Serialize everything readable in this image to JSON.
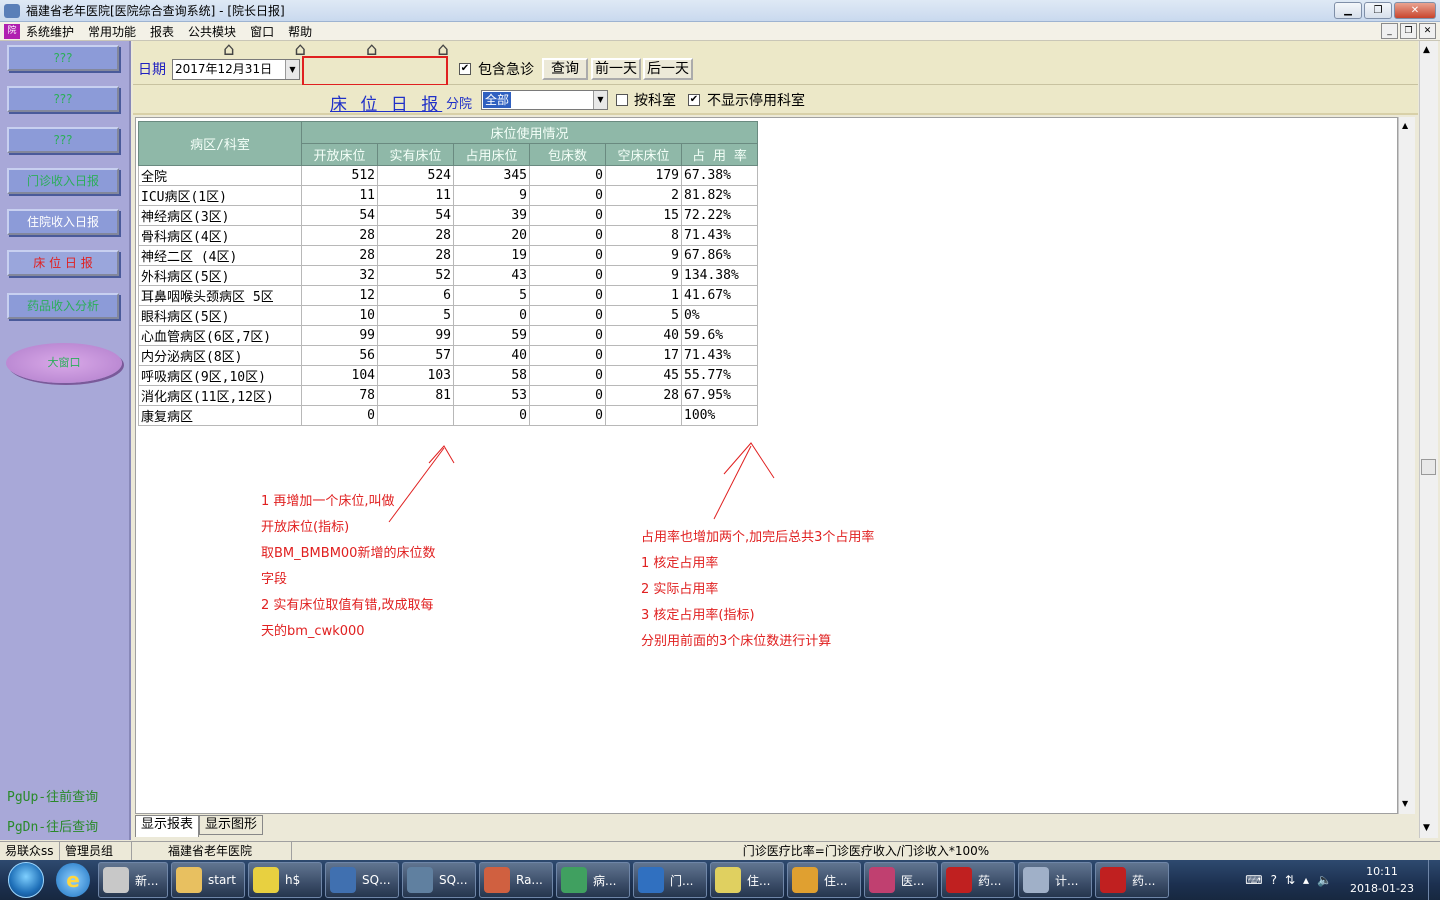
{
  "window": {
    "title": "福建省老年医院[医院综合查询系统] - [院长日报]"
  },
  "menu": {
    "items": [
      "系统维护",
      "常用功能",
      "报表",
      "公共模块",
      "窗口",
      "帮助"
    ]
  },
  "sidebar": {
    "buttons": [
      "???",
      "???",
      "???",
      "门诊收入日报",
      "住院收入日报",
      "床 位 日 报",
      "药品收入分析"
    ],
    "oval_label": "大窗口",
    "hint_up": "PgUp-往前查询",
    "hint_down": "PgDn-往后查询"
  },
  "toolbar": {
    "date_label": "日期",
    "date_value": "2017年12月31日",
    "include_emergency_label": "包含急诊",
    "include_emergency_checked": true,
    "query_button": "查询",
    "prev_day_button": "前一天",
    "next_day_button": "后一天",
    "report_title": "床 位 日 报",
    "branch_label": "分院",
    "branch_value": "全部",
    "by_dept_label": "按科室",
    "by_dept_checked": false,
    "hide_disabled_label": "不显示停用科室",
    "hide_disabled_checked": true
  },
  "table": {
    "corner_header": "病区/科室",
    "group_header": "床位使用情况",
    "columns": [
      "开放床位",
      "实有床位",
      "占用床位",
      "包床数",
      "空床床位",
      "占 用 率"
    ],
    "rows": [
      [
        "全院",
        "512",
        "524",
        "345",
        "0",
        "179",
        "67.38%"
      ],
      [
        "ICU病区(1区)",
        "11",
        "11",
        "9",
        "0",
        "2",
        "81.82%"
      ],
      [
        "神经病区(3区)",
        "54",
        "54",
        "39",
        "0",
        "15",
        "72.22%"
      ],
      [
        "骨科病区(4区)",
        "28",
        "28",
        "20",
        "0",
        "8",
        "71.43%"
      ],
      [
        "神经二区 (4区)",
        "28",
        "28",
        "19",
        "0",
        "9",
        "67.86%"
      ],
      [
        "外科病区(5区)",
        "32",
        "52",
        "43",
        "0",
        "9",
        "134.38%"
      ],
      [
        "耳鼻咽喉头颈病区 5区",
        "12",
        "6",
        "5",
        "0",
        "1",
        "41.67%"
      ],
      [
        "眼科病区(5区)",
        "10",
        "5",
        "0",
        "0",
        "5",
        "0%"
      ],
      [
        "心血管病区(6区,7区)",
        "99",
        "99",
        "59",
        "0",
        "40",
        "59.6%"
      ],
      [
        "内分泌病区(8区)",
        "56",
        "57",
        "40",
        "0",
        "17",
        "71.43%"
      ],
      [
        "呼吸病区(9区,10区)",
        "104",
        "103",
        "58",
        "0",
        "45",
        "55.77%"
      ],
      [
        "消化病区(11区,12区)",
        "78",
        "81",
        "53",
        "0",
        "28",
        "67.95%"
      ],
      [
        "康复病区",
        "0",
        "",
        "0",
        "0",
        "",
        "100%"
      ]
    ]
  },
  "annotations": {
    "left": [
      "1 再增加一个床位,叫做",
      "开放床位(指标)",
      "取BM_BMBM00新增的床位数",
      "字段",
      "2 实有床位取值有错,改成取每",
      "天的bm_cwk000"
    ],
    "right": [
      "占用率也增加两个,加完后总共3个占用率",
      "1 核定占用率",
      "2 实际占用率",
      "3 核定占用率(指标)",
      "分别用前面的3个床位数进行计算"
    ],
    "color": "#e02020"
  },
  "tabs": [
    "显示报表",
    "显示图形"
  ],
  "statusbar": [
    "易联众ss",
    "管理员组",
    "福建省老年医院",
    "门诊医疗比率=门诊医疗收入/门诊收入*100%"
  ],
  "taskbar": {
    "items": [
      {
        "label": "新...",
        "icon_color": "#c8c8c8"
      },
      {
        "label": "start",
        "icon_color": "#e8c060"
      },
      {
        "label": "h$",
        "icon_color": "#e8d040"
      },
      {
        "label": "SQ...",
        "icon_color": "#4070b0"
      },
      {
        "label": "SQ...",
        "icon_color": "#6080a0"
      },
      {
        "label": "Ra...",
        "icon_color": "#d06040"
      },
      {
        "label": "病...",
        "icon_color": "#40a060"
      },
      {
        "label": "门...",
        "icon_color": "#3070c0"
      },
      {
        "label": "住...",
        "icon_color": "#e0d060"
      },
      {
        "label": "住...",
        "icon_color": "#e0a030"
      },
      {
        "label": "医...",
        "icon_color": "#c04070"
      },
      {
        "label": "药...",
        "icon_color": "#c02020"
      },
      {
        "label": "计...",
        "icon_color": "#a0b0c8"
      },
      {
        "label": "药...",
        "icon_color": "#c02020"
      }
    ],
    "time": "10:11",
    "date": "2018-01-23"
  }
}
